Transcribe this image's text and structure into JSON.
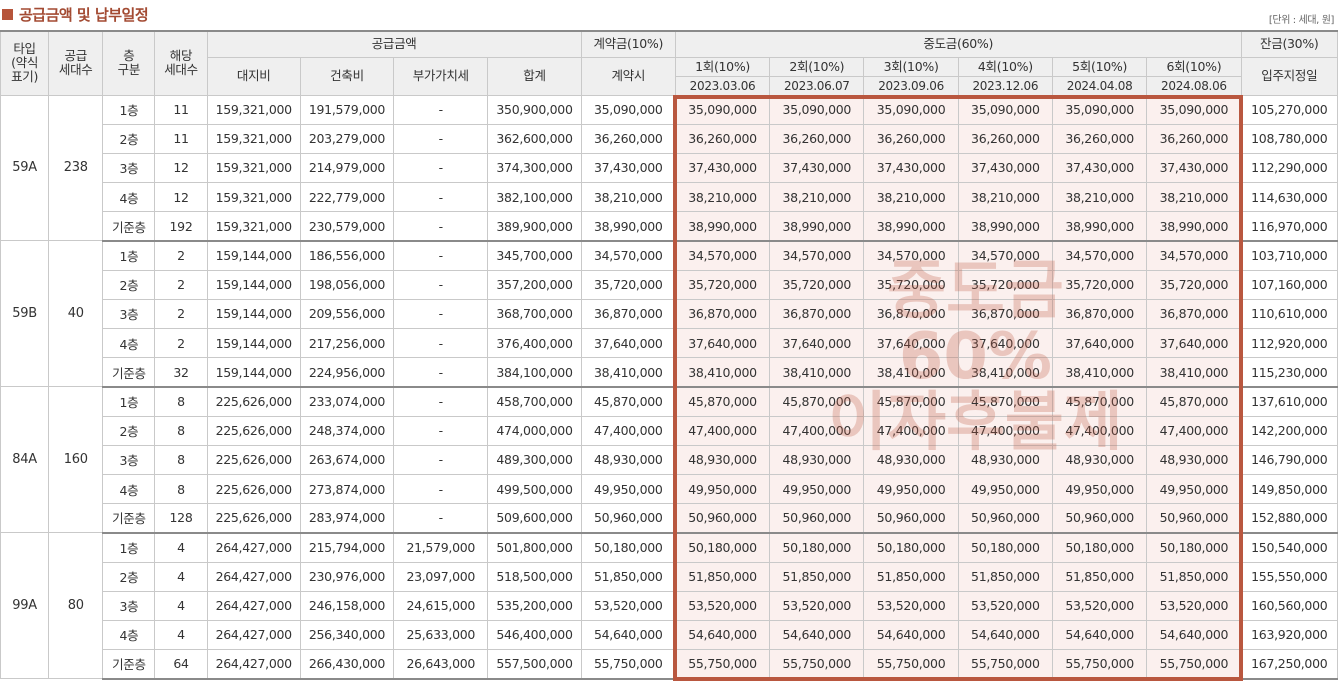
{
  "page_title": "공급금액 및 납부일정",
  "unit_note": "[단위 : 세대, 원]",
  "headers": {
    "type": "타입\n(약식\n표기)",
    "supply_units": "공급\n세대수",
    "floor_class": "층\n구분",
    "applicable_units": "해당\n세대수",
    "supply_amount": "공급금액",
    "land": "대지비",
    "building": "건축비",
    "vat": "부가가치세",
    "total": "합계",
    "deposit": "계약금(10%)",
    "deposit_when": "계약시",
    "middle": "중도금(60%)",
    "balance": "잔금(30%)",
    "balance_when": "입주지정일",
    "installments": [
      {
        "label": "1회(10%)",
        "date": "2023.03.06"
      },
      {
        "label": "2회(10%)",
        "date": "2023.06.07"
      },
      {
        "label": "3회(10%)",
        "date": "2023.09.06"
      },
      {
        "label": "4회(10%)",
        "date": "2023.12.06"
      },
      {
        "label": "5회(10%)",
        "date": "2024.04.08"
      },
      {
        "label": "6회(10%)",
        "date": "2024.08.06"
      }
    ]
  },
  "watermark": [
    "중도금",
    "60%",
    "이자후불제"
  ],
  "groups": [
    {
      "type": "59A",
      "units": "238",
      "rows": [
        {
          "floor": "1층",
          "count": "11",
          "land": "159,321,000",
          "building": "191,579,000",
          "vat": "-",
          "total": "350,900,000",
          "deposit": "35,090,000",
          "middle": "35,090,000",
          "balance": "105,270,000"
        },
        {
          "floor": "2층",
          "count": "11",
          "land": "159,321,000",
          "building": "203,279,000",
          "vat": "-",
          "total": "362,600,000",
          "deposit": "36,260,000",
          "middle": "36,260,000",
          "balance": "108,780,000"
        },
        {
          "floor": "3층",
          "count": "12",
          "land": "159,321,000",
          "building": "214,979,000",
          "vat": "-",
          "total": "374,300,000",
          "deposit": "37,430,000",
          "middle": "37,430,000",
          "balance": "112,290,000"
        },
        {
          "floor": "4층",
          "count": "12",
          "land": "159,321,000",
          "building": "222,779,000",
          "vat": "-",
          "total": "382,100,000",
          "deposit": "38,210,000",
          "middle": "38,210,000",
          "balance": "114,630,000"
        },
        {
          "floor": "기준층",
          "count": "192",
          "land": "159,321,000",
          "building": "230,579,000",
          "vat": "-",
          "total": "389,900,000",
          "deposit": "38,990,000",
          "middle": "38,990,000",
          "balance": "116,970,000"
        }
      ]
    },
    {
      "type": "59B",
      "units": "40",
      "rows": [
        {
          "floor": "1층",
          "count": "2",
          "land": "159,144,000",
          "building": "186,556,000",
          "vat": "-",
          "total": "345,700,000",
          "deposit": "34,570,000",
          "middle": "34,570,000",
          "balance": "103,710,000"
        },
        {
          "floor": "2층",
          "count": "2",
          "land": "159,144,000",
          "building": "198,056,000",
          "vat": "-",
          "total": "357,200,000",
          "deposit": "35,720,000",
          "middle": "35,720,000",
          "balance": "107,160,000"
        },
        {
          "floor": "3층",
          "count": "2",
          "land": "159,144,000",
          "building": "209,556,000",
          "vat": "-",
          "total": "368,700,000",
          "deposit": "36,870,000",
          "middle": "36,870,000",
          "balance": "110,610,000"
        },
        {
          "floor": "4층",
          "count": "2",
          "land": "159,144,000",
          "building": "217,256,000",
          "vat": "-",
          "total": "376,400,000",
          "deposit": "37,640,000",
          "middle": "37,640,000",
          "balance": "112,920,000"
        },
        {
          "floor": "기준층",
          "count": "32",
          "land": "159,144,000",
          "building": "224,956,000",
          "vat": "-",
          "total": "384,100,000",
          "deposit": "38,410,000",
          "middle": "38,410,000",
          "balance": "115,230,000"
        }
      ]
    },
    {
      "type": "84A",
      "units": "160",
      "rows": [
        {
          "floor": "1층",
          "count": "8",
          "land": "225,626,000",
          "building": "233,074,000",
          "vat": "-",
          "total": "458,700,000",
          "deposit": "45,870,000",
          "middle": "45,870,000",
          "balance": "137,610,000"
        },
        {
          "floor": "2층",
          "count": "8",
          "land": "225,626,000",
          "building": "248,374,000",
          "vat": "-",
          "total": "474,000,000",
          "deposit": "47,400,000",
          "middle": "47,400,000",
          "balance": "142,200,000"
        },
        {
          "floor": "3층",
          "count": "8",
          "land": "225,626,000",
          "building": "263,674,000",
          "vat": "-",
          "total": "489,300,000",
          "deposit": "48,930,000",
          "middle": "48,930,000",
          "balance": "146,790,000"
        },
        {
          "floor": "4층",
          "count": "8",
          "land": "225,626,000",
          "building": "273,874,000",
          "vat": "-",
          "total": "499,500,000",
          "deposit": "49,950,000",
          "middle": "49,950,000",
          "balance": "149,850,000"
        },
        {
          "floor": "기준층",
          "count": "128",
          "land": "225,626,000",
          "building": "283,974,000",
          "vat": "-",
          "total": "509,600,000",
          "deposit": "50,960,000",
          "middle": "50,960,000",
          "balance": "152,880,000"
        }
      ]
    },
    {
      "type": "99A",
      "units": "80",
      "rows": [
        {
          "floor": "1층",
          "count": "4",
          "land": "264,427,000",
          "building": "215,794,000",
          "vat": "21,579,000",
          "total": "501,800,000",
          "deposit": "50,180,000",
          "middle": "50,180,000",
          "balance": "150,540,000"
        },
        {
          "floor": "2층",
          "count": "4",
          "land": "264,427,000",
          "building": "230,976,000",
          "vat": "23,097,000",
          "total": "518,500,000",
          "deposit": "51,850,000",
          "middle": "51,850,000",
          "balance": "155,550,000"
        },
        {
          "floor": "3층",
          "count": "4",
          "land": "264,427,000",
          "building": "246,158,000",
          "vat": "24,615,000",
          "total": "535,200,000",
          "deposit": "53,520,000",
          "middle": "53,520,000",
          "balance": "160,560,000"
        },
        {
          "floor": "4층",
          "count": "4",
          "land": "264,427,000",
          "building": "256,340,000",
          "vat": "25,633,000",
          "total": "546,400,000",
          "deposit": "54,640,000",
          "middle": "54,640,000",
          "balance": "163,920,000"
        },
        {
          "floor": "기준층",
          "count": "64",
          "land": "264,427,000",
          "building": "266,430,000",
          "vat": "26,643,000",
          "total": "557,500,000",
          "deposit": "55,750,000",
          "middle": "55,750,000",
          "balance": "167,250,000"
        }
      ]
    }
  ]
}
